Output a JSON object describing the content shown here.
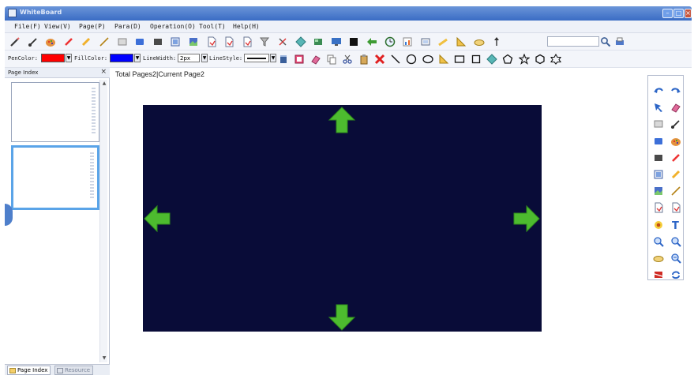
{
  "window": {
    "title": "WhiteBoard"
  },
  "menu": [
    "File(F)",
    "View(V)",
    "Page(P)",
    "Para(D)",
    "Operation(O)",
    "Tool(T)",
    "Help(H)"
  ],
  "toolbar2": {
    "pen_color_label": "PenColor:",
    "pen_color": "#ff0000",
    "fill_color_label": "FillColor:",
    "fill_color": "#0000ff",
    "line_width_label": "LineWidth:",
    "line_width_value": "2px",
    "line_style_label": "LineStyle:"
  },
  "side_panel": {
    "title": "Page Index",
    "close_glyph": "×",
    "tabs": [
      "Page Index",
      "Resource"
    ]
  },
  "status": {
    "text": "Total Pages2|Current Page2"
  },
  "colors": {
    "canvas_bg": "#090c38",
    "arrow_green": "#4dbb2f",
    "selection_blue": "#5aa4e8"
  },
  "icons_row1": [
    "pencil-icon",
    "brush-icon",
    "palette-icon",
    "marker-icon",
    "highlighter-icon",
    "pen-icon",
    "rect-icon",
    "blue-rect-icon",
    "gray-rect-icon",
    "picture-icon",
    "image-icon",
    "page-icon",
    "page-icon",
    "page-icon",
    "funnel-icon",
    "scissors-icon",
    "diamond-icon",
    "green-box-icon",
    "monitor-icon",
    "black-square-icon",
    "left-arrow-icon",
    "clock-icon",
    "chart-icon",
    "film-icon",
    "yellow-pencil-icon",
    "triangle-icon",
    "cloud-icon",
    "pointer-icon",
    "search-icon",
    "printer-icon"
  ],
  "icons_row2": [
    "bucket-icon",
    "image-edit-icon",
    "eraser-icon",
    "copy-icon",
    "cut-icon",
    "paste-icon",
    "delete-icon",
    "line-icon",
    "circle-icon",
    "ellipse-icon",
    "triangle-icon",
    "rectangle-icon",
    "square-icon",
    "diamond-icon",
    "pentagon-icon",
    "star-icon",
    "hexagon-icon",
    "star6-icon"
  ],
  "icons_right": [
    "undo-icon",
    "redo-icon",
    "select-icon",
    "eraser-icon",
    "rect-icon",
    "brush-icon",
    "blue-rect-icon",
    "palette-icon",
    "gray-rect-icon",
    "marker-icon",
    "picture-icon",
    "highlighter-icon",
    "image-icon",
    "pen-icon",
    "page-icon",
    "page-icon",
    "flower-icon",
    "text-icon",
    "zoom-in-icon",
    "zoom-in-icon",
    "cloud-icon",
    "zoom-out-icon",
    "flag-icon",
    "refresh-icon"
  ]
}
